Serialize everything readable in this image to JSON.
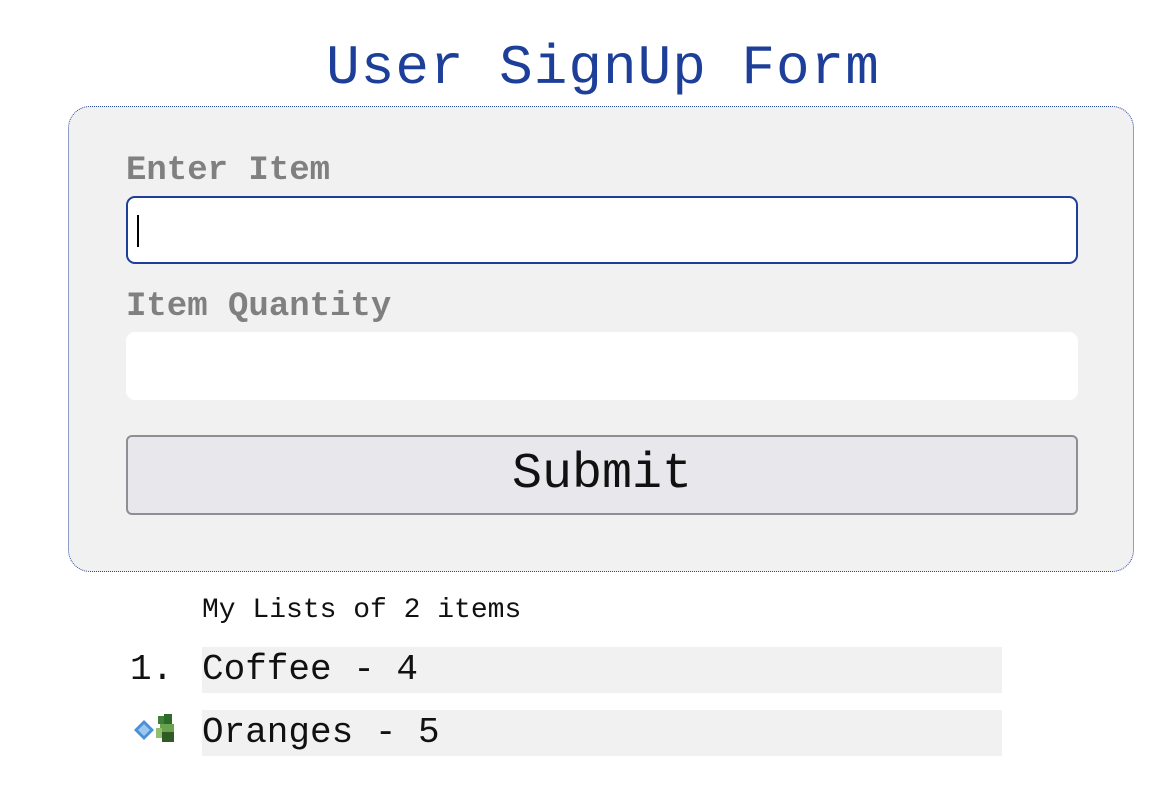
{
  "title": "User SignUp Form",
  "form": {
    "item_label": "Enter Item",
    "item_value": "",
    "quantity_label": "Item Quantity",
    "quantity_value": "",
    "submit_label": "Submit"
  },
  "list": {
    "heading": "My Lists of 2 items",
    "items": [
      {
        "marker": "1.",
        "text": "Coffee - 4"
      },
      {
        "marker": "",
        "text": "Oranges - 5",
        "marker_icon": "broken-image-icon"
      }
    ]
  },
  "colors": {
    "title": "#1d3f99",
    "form_background": "#f1f1f2",
    "label": "#808080",
    "focus_border": "#1d3f99",
    "button_background": "#e8e8ec"
  }
}
